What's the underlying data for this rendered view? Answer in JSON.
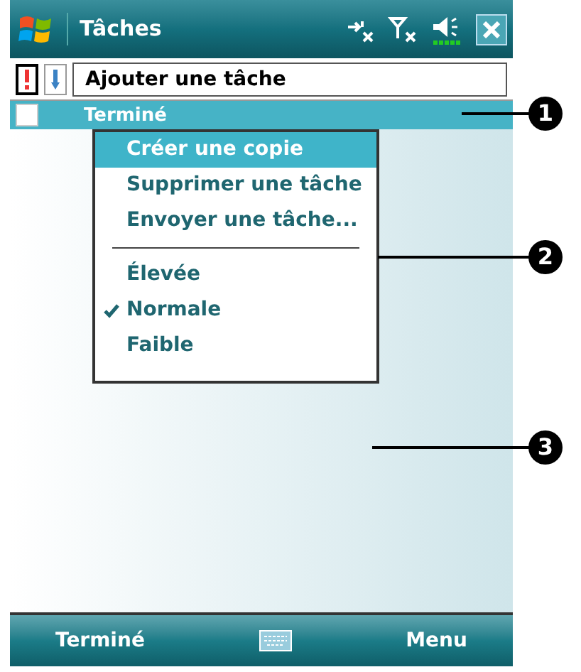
{
  "title_bar": {
    "title": "Tâches"
  },
  "toolbar": {
    "field_placeholder": "Ajouter une tâche"
  },
  "tasks": [
    {
      "name": "Terminé",
      "checked": false,
      "selected": true
    }
  ],
  "context_menu": {
    "items": [
      {
        "label": "Créer une copie",
        "kind": "command",
        "selected": true,
        "checked": false
      },
      {
        "label": "Supprimer une tâche",
        "kind": "command",
        "selected": false,
        "checked": false
      },
      {
        "label": "Envoyer une tâche...",
        "kind": "command",
        "selected": false,
        "checked": false
      },
      {
        "kind": "separator"
      },
      {
        "label": "Élevée",
        "kind": "option",
        "selected": false,
        "checked": false
      },
      {
        "label": "Normale",
        "kind": "option",
        "selected": false,
        "checked": true
      },
      {
        "label": "Faible",
        "kind": "option",
        "selected": false,
        "checked": false
      }
    ]
  },
  "soft_keys": {
    "left": "Terminé",
    "right": "Menu"
  },
  "callouts": [
    "1",
    "2",
    "3"
  ]
}
